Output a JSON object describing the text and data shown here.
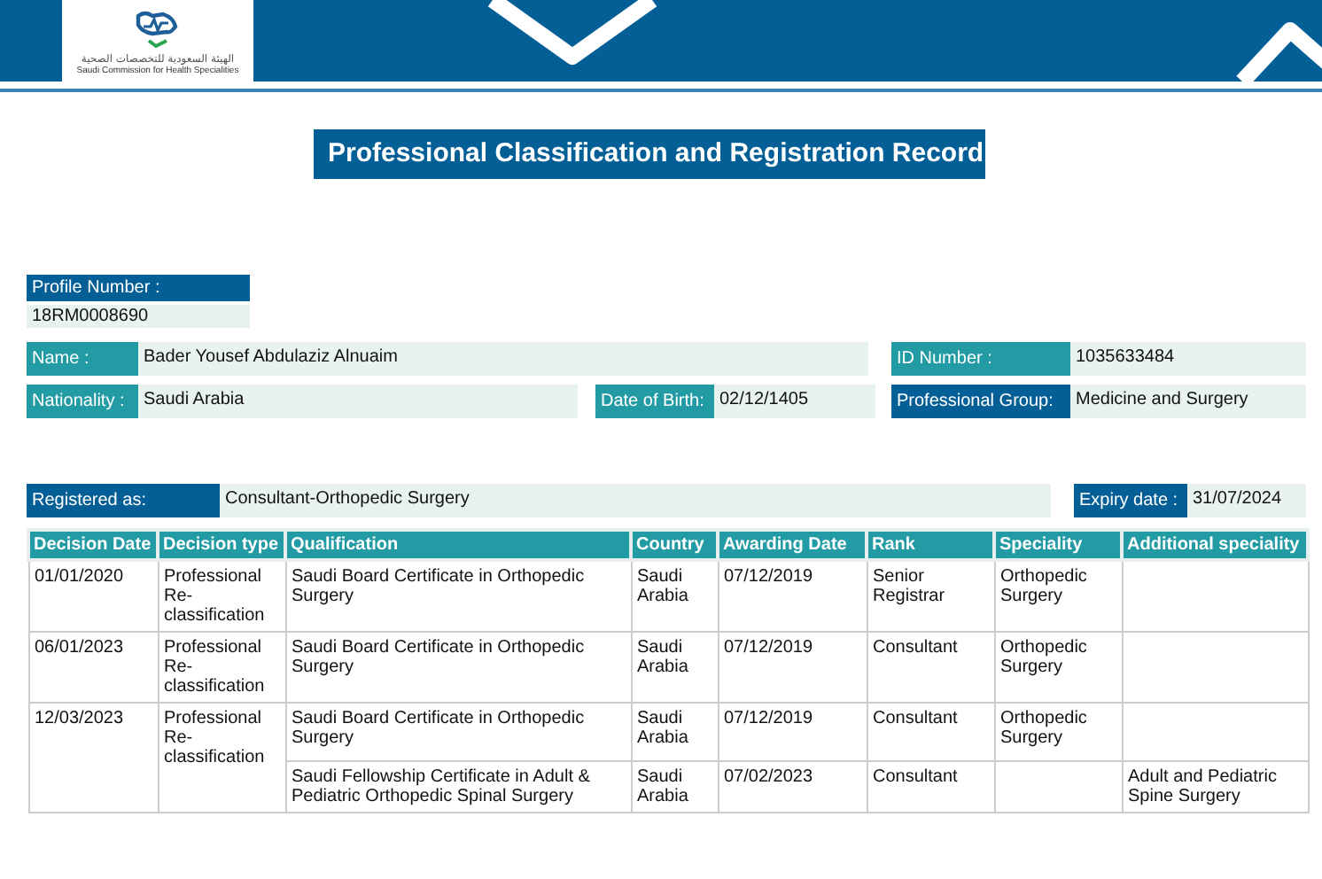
{
  "header": {
    "logo_arabic": "الهيئة السعودية للتخصصات الصحية",
    "logo_english": "Saudi Commission for Health Specialities"
  },
  "title": "Professional Classification and Registration Record",
  "profile": {
    "label": "Profile Number :",
    "value": "18RM0008690"
  },
  "name": {
    "label": "Name :",
    "value": "Bader Yousef Abdulaziz Alnuaim"
  },
  "id_number": {
    "label": "ID Number :",
    "value": "1035633484"
  },
  "nationality": {
    "label": "Nationality :",
    "value": "Saudi Arabia"
  },
  "date_of_birth": {
    "label": "Date of Birth:",
    "value": "02/12/1405"
  },
  "professional_group": {
    "label": "Professional Group:",
    "value": "Medicine and Surgery"
  },
  "registered_as": {
    "label": "Registered as:",
    "value": "Consultant-Orthopedic Surgery"
  },
  "expiry_date": {
    "label": "Expiry date :",
    "value": "31/07/2024"
  },
  "table": {
    "columns": [
      "Decision Date",
      "Decision type",
      "Qualification",
      "Country",
      "Awarding Date",
      "Rank",
      "Speciality",
      "Additional speciality"
    ],
    "rows": [
      {
        "decision_date": "01/01/2020",
        "decision_type": "Professional Re-classification",
        "entries": [
          {
            "qualification": "Saudi Board Certificate in Orthopedic Surgery",
            "country": "Saudi Arabia",
            "awarding_date": "07/12/2019",
            "rank": "Senior Registrar",
            "speciality": "Orthopedic Surgery"
          }
        ]
      },
      {
        "decision_date": "06/01/2023",
        "decision_type": "Professional Re-classification",
        "entries": [
          {
            "qualification": "Saudi Board Certificate in Orthopedic Surgery",
            "country": "Saudi Arabia",
            "awarding_date": "07/12/2019",
            "rank": "Consultant",
            "speciality": "Orthopedic Surgery"
          }
        ]
      },
      {
        "decision_date": "12/03/2023",
        "decision_type": "Professional Re-classification",
        "entries": [
          {
            "qualification": "Saudi Board Certificate in Orthopedic Surgery",
            "country": "Saudi Arabia",
            "awarding_date": "07/12/2019",
            "rank": "Consultant",
            "speciality": "Orthopedic Surgery"
          },
          {
            "qualification": "Saudi Fellowship Certificate in Adult & Pediatric Orthopedic Spinal Surgery",
            "country": "Saudi Arabia",
            "awarding_date": "07/02/2023",
            "rank": "Consultant",
            "additional_speciality": "Adult and Pediatric Spine Surgery"
          }
        ]
      }
    ]
  }
}
